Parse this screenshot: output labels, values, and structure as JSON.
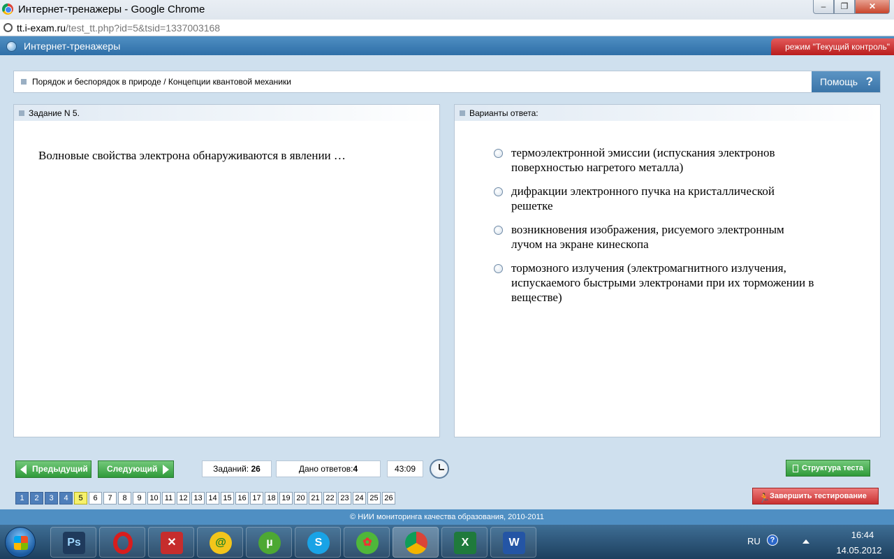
{
  "window": {
    "title": "Интернет-тренажеры - Google Chrome",
    "controls": {
      "minimize": "‒",
      "maximize": "❐",
      "close": "✕"
    }
  },
  "address": {
    "host": "tt.i-exam.ru",
    "path": "/test_tt.php?id=5&tsid=1337003168"
  },
  "app": {
    "title": "Интернет-тренажеры",
    "mode": "режим \"Текущий контроль\""
  },
  "breadcrumb": "Порядок и беспорядок в природе / Концепции квантовой механики",
  "help": {
    "label": "Помощь",
    "icon": "?"
  },
  "task": {
    "header": "Задание N 5.",
    "question": "Волновые свойства электрона обнаруживаются в явлении …"
  },
  "answers": {
    "header": "Варианты ответа:",
    "options": [
      "термоэлектронной эмиссии (испускания электронов поверхностью нагретого металла)",
      "дифракции электронного пучка на кристаллической решетке",
      "возникновения изображения, рисуемого электронным лучом на экране кинескопа",
      "тормозного излучения (электромагнитного излучения, испускаемого быстрыми электронами при их торможении в веществе)"
    ]
  },
  "controls": {
    "prev": "Предыдущий",
    "next": "Следующий",
    "tasks_label": "Заданий:",
    "tasks_value": "26",
    "answered_label": "Дано ответов:",
    "answered_value": "4",
    "timer": "43:09",
    "structure": "Структура теста",
    "finish": "Завершить тестирование"
  },
  "pages": [
    "1",
    "2",
    "3",
    "4",
    "5",
    "6",
    "7",
    "8",
    "9",
    "10",
    "11",
    "12",
    "13",
    "14",
    "15",
    "16",
    "17",
    "18",
    "19",
    "20",
    "21",
    "22",
    "23",
    "24",
    "25",
    "26"
  ],
  "footer": "© НИИ мониторинга качества образования, 2010-2011",
  "taskbar": {
    "apps": [
      {
        "name": "photoshop",
        "glyph": "Ps"
      },
      {
        "name": "opera",
        "glyph": ""
      },
      {
        "name": "acrobat",
        "glyph": "✕"
      },
      {
        "name": "mail-agent",
        "glyph": "@"
      },
      {
        "name": "utorrent",
        "glyph": "µ"
      },
      {
        "name": "skype",
        "glyph": "S"
      },
      {
        "name": "icq",
        "glyph": "✿"
      },
      {
        "name": "chrome",
        "glyph": ""
      },
      {
        "name": "excel",
        "glyph": "X"
      },
      {
        "name": "word",
        "glyph": "W"
      }
    ],
    "lang": "RU",
    "time": "16:44",
    "date": "14.05.2012"
  }
}
